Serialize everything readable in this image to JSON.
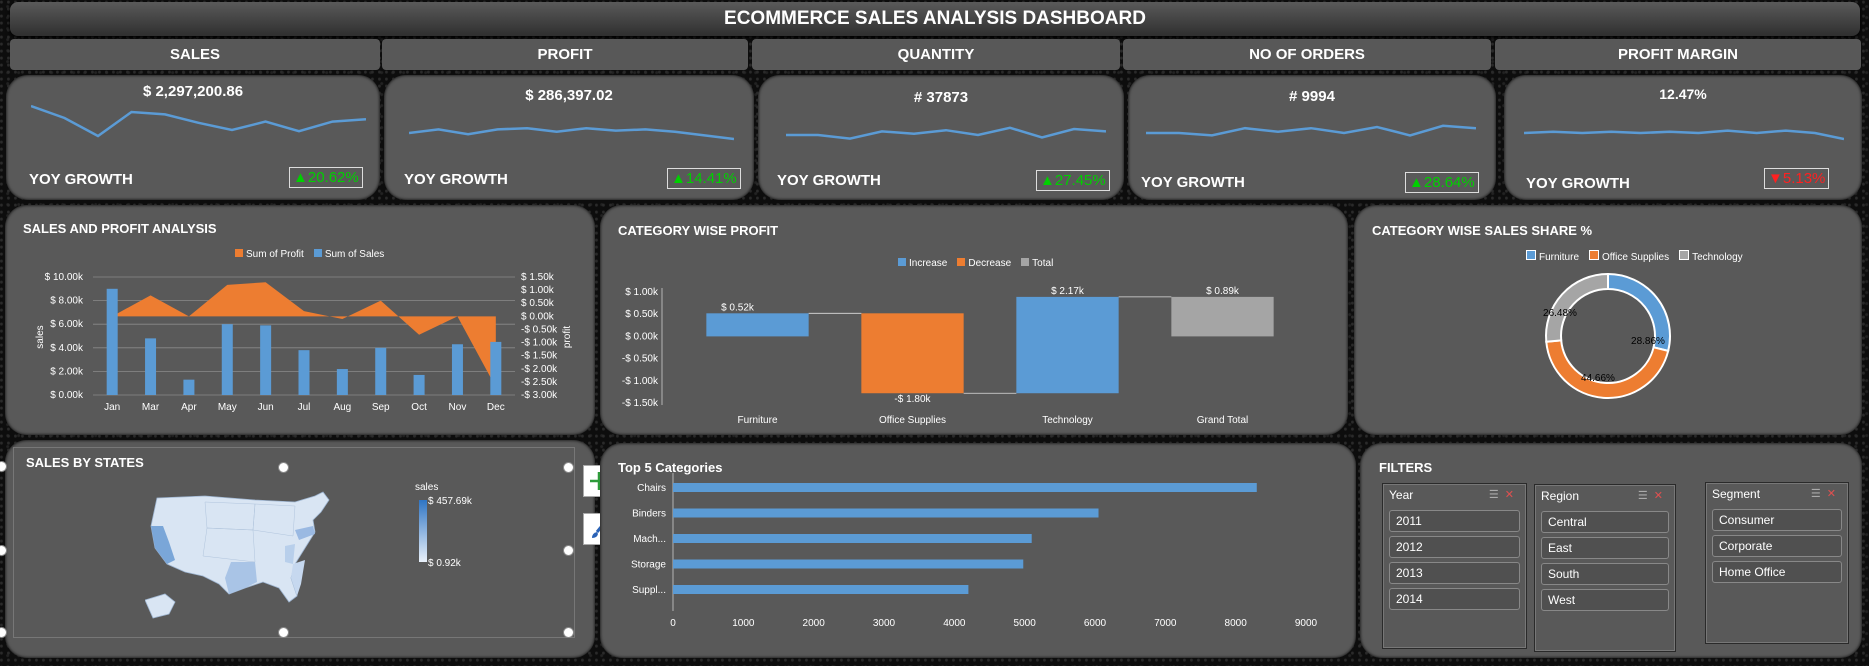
{
  "header": {
    "title": "ECOMMERCE SALES ANALYSIS DASHBOARD"
  },
  "kpis": [
    {
      "label": "SALES",
      "value": "$ 2,297,200.86",
      "yoy_label": "YOY GROWTH",
      "growth": "20.62%",
      "direction": "up",
      "spark": [
        9,
        7,
        4,
        8,
        7.6,
        6.2,
        5,
        6.4,
        4.8,
        6.4,
        6.8
      ]
    },
    {
      "label": "PROFIT",
      "value": "$ 286,397.02",
      "yoy_label": "YOY GROWTH",
      "growth": "14.41%",
      "direction": "up",
      "spark": [
        5,
        5.6,
        4.8,
        5.6,
        5.8,
        5.2,
        5.8,
        5.4,
        5.6,
        5.2,
        4.6,
        4
      ]
    },
    {
      "label": "QUANTITY",
      "value": "# 37873",
      "yoy_label": "YOY GROWTH",
      "growth": "27.45%",
      "direction": "up",
      "spark": [
        5,
        5,
        4.4,
        5.6,
        5.2,
        5.8,
        5,
        6.2,
        4.6,
        6,
        5.6
      ]
    },
    {
      "label": "NO OF ORDERS",
      "value": "# 9994",
      "yoy_label": "YOY GROWTH",
      "growth": "28.64%",
      "direction": "up",
      "spark": [
        5,
        5,
        4.6,
        5.8,
        5.2,
        5.8,
        5,
        6,
        4.6,
        6.2,
        5.8
      ]
    },
    {
      "label": "PROFIT MARGIN",
      "value": "12.47%",
      "yoy_label": "YOY GROWTH",
      "growth": "5.13%",
      "direction": "down",
      "spark": [
        5,
        5.2,
        5,
        5.2,
        5,
        5.2,
        5,
        5.4,
        5,
        5.4,
        5,
        4
      ]
    }
  ],
  "sales_profit": {
    "title": "SALES AND PROFIT ANALYSIS",
    "legend": [
      "Sum of Profit",
      "Sum of Sales"
    ],
    "colors": {
      "profit": "#ED7D31",
      "sales": "#5B9BD5"
    },
    "y_left_label": "sales",
    "y_right_label": "profit",
    "y_left_ticks": [
      "$ 10.00k",
      "$ 8.00k",
      "$ 6.00k",
      "$ 4.00k",
      "$ 2.00k",
      "$ 0.00k"
    ],
    "y_right_ticks": [
      "$ 1.50k",
      "$ 1.00k",
      "$ 0.50k",
      "$ 0.00k",
      "-$ 0.50k",
      "-$ 1.00k",
      "-$ 1.50k",
      "-$ 2.00k",
      "-$ 2.50k",
      "-$ 3.00k"
    ],
    "months": [
      "Jan",
      "Mar",
      "Apr",
      "May",
      "Jun",
      "Jul",
      "Aug",
      "Sep",
      "Oct",
      "Nov",
      "Dec"
    ],
    "sales": [
      9.0,
      4.8,
      1.3,
      6.0,
      5.9,
      3.8,
      2.2,
      4.0,
      1.7,
      4.3,
      4.5
    ],
    "profit": [
      0.0,
      0.8,
      0.0,
      1.2,
      1.3,
      0.2,
      -0.1,
      0.6,
      -0.7,
      0.0,
      -2.7
    ]
  },
  "category_profit": {
    "title": "CATEGORY WISE PROFIT",
    "legend": [
      "Increase",
      "Decrease",
      "Total"
    ],
    "colors": {
      "increase": "#5B9BD5",
      "decrease": "#ED7D31",
      "total": "#A5A5A5"
    },
    "y_ticks": [
      "$ 1.00k",
      "$ 0.50k",
      "$ 0.00k",
      "-$ 0.50k",
      "-$ 1.00k",
      "-$ 1.50k"
    ],
    "categories": [
      "Furniture",
      "Office Supplies",
      "Technology",
      "Grand Total"
    ],
    "values": [
      0.52,
      -1.8,
      2.17,
      0.89
    ],
    "labels": [
      "$ 0.52k",
      "-$ 1.80k",
      "$ 2.17k",
      "$ 0.89k"
    ]
  },
  "category_share": {
    "title": "CATEGORY WISE SALES SHARE %",
    "legend": [
      "Furniture",
      "Office Supplies",
      "Technology"
    ],
    "values": [
      28.86,
      44.66,
      26.48
    ],
    "labels": [
      "28.86%",
      "44.66%",
      "26.48%"
    ],
    "colors": [
      "#5B9BD5",
      "#ED7D31",
      "#A5A5A5"
    ]
  },
  "states": {
    "title": "SALES BY STATES",
    "legend_title": "sales",
    "max_label": "$ 457.69k",
    "min_label": "$ 0.92k"
  },
  "top5": {
    "title": "Top 5 Categories",
    "categories": [
      "Chairs",
      "Binders",
      "Mach...",
      "Storage",
      "Suppl..."
    ],
    "values": [
      8300,
      6050,
      5100,
      4980,
      4200
    ],
    "x_ticks": [
      "0",
      "1000",
      "2000",
      "3000",
      "4000",
      "5000",
      "6000",
      "7000",
      "8000",
      "9000"
    ],
    "color": "#5B9BD5"
  },
  "filters": {
    "title": "FILTERS",
    "year": {
      "label": "Year",
      "items": [
        "2011",
        "2012",
        "2013",
        "2014"
      ]
    },
    "region": {
      "label": "Region",
      "items": [
        "Central",
        "East",
        "South",
        "West"
      ]
    },
    "segment": {
      "label": "Segment",
      "items": [
        "Consumer",
        "Corporate",
        "Home Office"
      ]
    }
  }
}
